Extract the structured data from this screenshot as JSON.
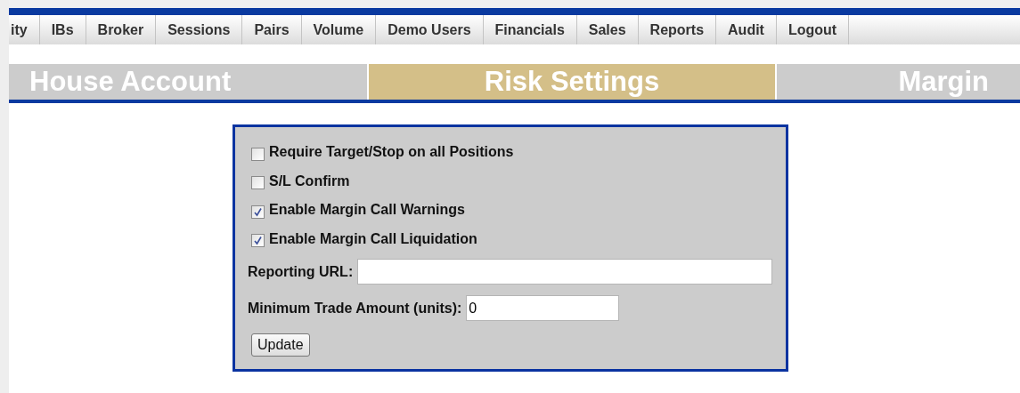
{
  "nav": [
    {
      "label": "ity",
      "selected": false
    },
    {
      "label": "IBs",
      "selected": false
    },
    {
      "label": "Broker",
      "selected": false
    },
    {
      "label": "Sessions",
      "selected": false
    },
    {
      "label": "Pairs",
      "selected": false
    },
    {
      "label": "Volume",
      "selected": false
    },
    {
      "label": "Demo Users",
      "selected": false
    },
    {
      "label": "Financials",
      "selected": false
    },
    {
      "label": "Sales",
      "selected": false
    },
    {
      "label": "Reports",
      "selected": false
    },
    {
      "label": "Audit",
      "selected": false
    },
    {
      "label": "Logout",
      "selected": false
    }
  ],
  "section_tabs": [
    {
      "label": "House Account",
      "selected": false
    },
    {
      "label": "Risk Settings",
      "selected": true
    },
    {
      "label": "Margin",
      "selected": false
    }
  ],
  "options": [
    {
      "label": "Require Target/Stop on all Positions",
      "checked": false
    },
    {
      "label": "S/L Confirm",
      "checked": false
    },
    {
      "label": "Enable Margin Call Warnings",
      "checked": true
    },
    {
      "label": "Enable Margin Call Liquidation",
      "checked": true
    }
  ],
  "fields": [
    {
      "label": "Reporting URL:"
    },
    {
      "label": "Minimum Trade Amount (units):",
      "value": "0"
    }
  ],
  "update_button": "Update"
}
